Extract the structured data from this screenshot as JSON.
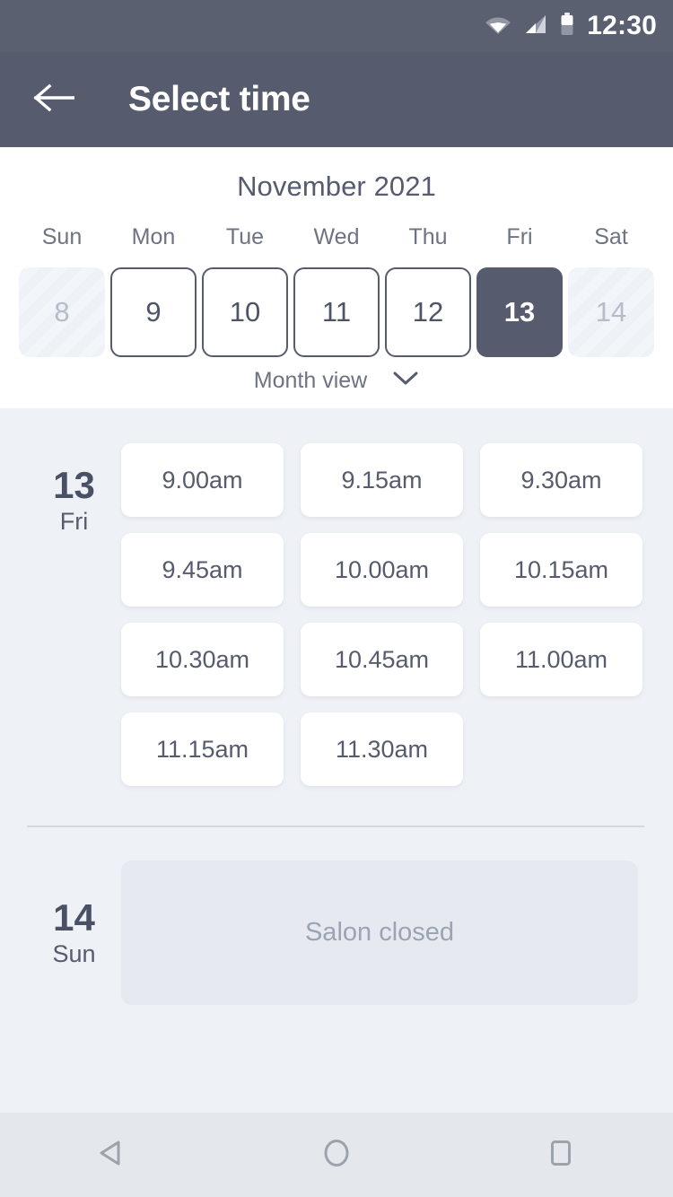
{
  "status_bar": {
    "time": "12:30",
    "icons": [
      "wifi-icon",
      "cellular-signal-icon",
      "battery-icon"
    ]
  },
  "app_bar": {
    "back_icon": "back-arrow-icon",
    "title": "Select time"
  },
  "calendar": {
    "month_title": "November 2021",
    "day_names": [
      "Sun",
      "Mon",
      "Tue",
      "Wed",
      "Thu",
      "Fri",
      "Sat"
    ],
    "days": [
      {
        "num": "8",
        "state": "disabled"
      },
      {
        "num": "9",
        "state": "enabled"
      },
      {
        "num": "10",
        "state": "enabled"
      },
      {
        "num": "11",
        "state": "enabled"
      },
      {
        "num": "12",
        "state": "enabled"
      },
      {
        "num": "13",
        "state": "selected"
      },
      {
        "num": "14",
        "state": "disabled"
      }
    ],
    "view_toggle": {
      "label": "Month view",
      "icon": "chevron-down-icon"
    }
  },
  "schedule": {
    "days": [
      {
        "date_num": "13",
        "weekday": "Fri",
        "closed": false,
        "slots": [
          "9.00am",
          "9.15am",
          "9.30am",
          "9.45am",
          "10.00am",
          "10.15am",
          "10.30am",
          "10.45am",
          "11.00am",
          "11.15am",
          "11.30am"
        ]
      },
      {
        "date_num": "14",
        "weekday": "Sun",
        "closed": true,
        "closed_label": "Salon closed",
        "slots": []
      }
    ]
  },
  "nav_bar": {
    "buttons": [
      {
        "icon": "back-triangle-icon"
      },
      {
        "icon": "home-circle-icon"
      },
      {
        "icon": "recents-square-icon"
      }
    ]
  },
  "colors": {
    "appbar": "#565b6e",
    "statusbar": "#5a6070",
    "page_bg": "#eef1f6",
    "card_bg": "#ffffff",
    "selected_day": "#565b6e",
    "text_primary": "#565b6e",
    "text_muted": "#9ba3b4",
    "closed_card": "#e6eaf0",
    "navbar": "#e4e7ec"
  }
}
